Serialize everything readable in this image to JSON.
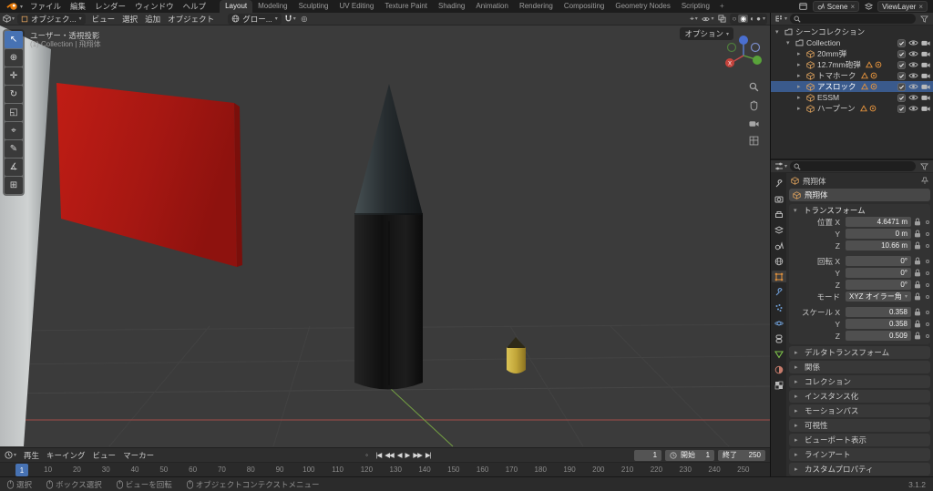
{
  "colors": {
    "accent": "#4772b3",
    "selection": "#3a5a8c",
    "flag_red": "#a51712",
    "axis_red": "#a34c48",
    "axis_green": "#74a043"
  },
  "topbar": {
    "menus": [
      "ファイル",
      "編集",
      "レンダー",
      "ウィンドウ",
      "ヘルプ"
    ],
    "tabs": [
      "Layout",
      "Modeling",
      "Sculpting",
      "UV Editing",
      "Texture Paint",
      "Shading",
      "Animation",
      "Rendering",
      "Compositing",
      "Geometry Nodes",
      "Scripting"
    ],
    "active_tab": "Layout",
    "add_tab": "+",
    "scene_label": "Scene",
    "viewlayer_label": "ViewLayer"
  },
  "vp_header": {
    "mode": "オブジェク...",
    "menus": [
      "ビュー",
      "選択",
      "追加",
      "オブジェクト"
    ],
    "orientation": "グロー..."
  },
  "viewport": {
    "view_label": "ユーザー・透視投影",
    "collection_label": "(1) Collection | 飛翔体",
    "options_label": "オプション",
    "tools": [
      "select-box",
      "cursor",
      "move",
      "rotate",
      "scale",
      "transform",
      "annotate",
      "measure",
      "add-cube"
    ],
    "active_tool": "select-box"
  },
  "outliner": {
    "scene_collection": "シーンコレクション",
    "collection": {
      "name": "Collection"
    },
    "items": [
      {
        "name": "20mm弾",
        "extras": 0,
        "selected": false
      },
      {
        "name": "12.7mm砲弾",
        "extras": 2,
        "selected": false
      },
      {
        "name": "トマホーク",
        "extras": 2,
        "selected": false
      },
      {
        "name": "アスロック",
        "extras": 2,
        "selected": true
      },
      {
        "name": "ESSM",
        "extras": 0,
        "selected": false
      },
      {
        "name": "ハープーン",
        "extras": 2,
        "selected": false
      }
    ]
  },
  "properties": {
    "tabs": [
      "tool-icon",
      "render-icon",
      "output-icon",
      "viewlayer-icon",
      "scene-icon",
      "world-icon",
      "object-icon",
      "modifiers-icon",
      "particles-icon",
      "physics-icon",
      "constraints-icon",
      "data-icon",
      "material-icon",
      "texture-icon"
    ],
    "active_tab": "object-icon",
    "breadcrumb": "飛翔体",
    "name": "飛翔体",
    "transform_title": "トランスフォーム",
    "rows": [
      {
        "label": "位置 X",
        "value": "4.6471 m",
        "dropdown": false,
        "gap_after": false
      },
      {
        "label": "Y",
        "value": "0 m",
        "dropdown": false,
        "gap_after": false
      },
      {
        "label": "Z",
        "value": "10.66 m",
        "dropdown": false,
        "gap_after": true
      },
      {
        "label": "回転 X",
        "value": "0°",
        "dropdown": false,
        "gap_after": false
      },
      {
        "label": "Y",
        "value": "0°",
        "dropdown": false,
        "gap_after": false
      },
      {
        "label": "Z",
        "value": "0°",
        "dropdown": false,
        "gap_after": false
      },
      {
        "label": "モード",
        "value": "XYZ オイラー角",
        "dropdown": true,
        "gap_after": true
      },
      {
        "label": "スケール X",
        "value": "0.358",
        "dropdown": false,
        "gap_after": false
      },
      {
        "label": "Y",
        "value": "0.358",
        "dropdown": false,
        "gap_after": false
      },
      {
        "label": "Z",
        "value": "0.509",
        "dropdown": false,
        "gap_after": false
      }
    ],
    "sections": [
      "デルタトランスフォーム",
      "関係",
      "コレクション",
      "インスタンス化",
      "モーションパス",
      "可視性",
      "ビューポート表示",
      "ラインアート",
      "カスタムプロパティ"
    ]
  },
  "timeline": {
    "menus": [
      "再生",
      "キーイング",
      "ビュー",
      "マーカー"
    ],
    "transport": [
      "jump-start",
      "prev-keyframe",
      "play-reverse",
      "play",
      "next-keyframe",
      "jump-end"
    ],
    "frame": "1",
    "start_label": "開始",
    "start": "1",
    "end_label": "終了",
    "end": "250",
    "ruler": [
      1,
      10,
      20,
      30,
      40,
      50,
      60,
      70,
      80,
      90,
      100,
      110,
      120,
      130,
      140,
      150,
      160,
      170,
      180,
      190,
      200,
      210,
      220,
      230,
      240,
      250
    ]
  },
  "statusbar": {
    "items": [
      "選択",
      "ボックス選択",
      "ビューを回転",
      "オブジェクトコンテクストメニュー"
    ],
    "version": "3.1.2"
  }
}
